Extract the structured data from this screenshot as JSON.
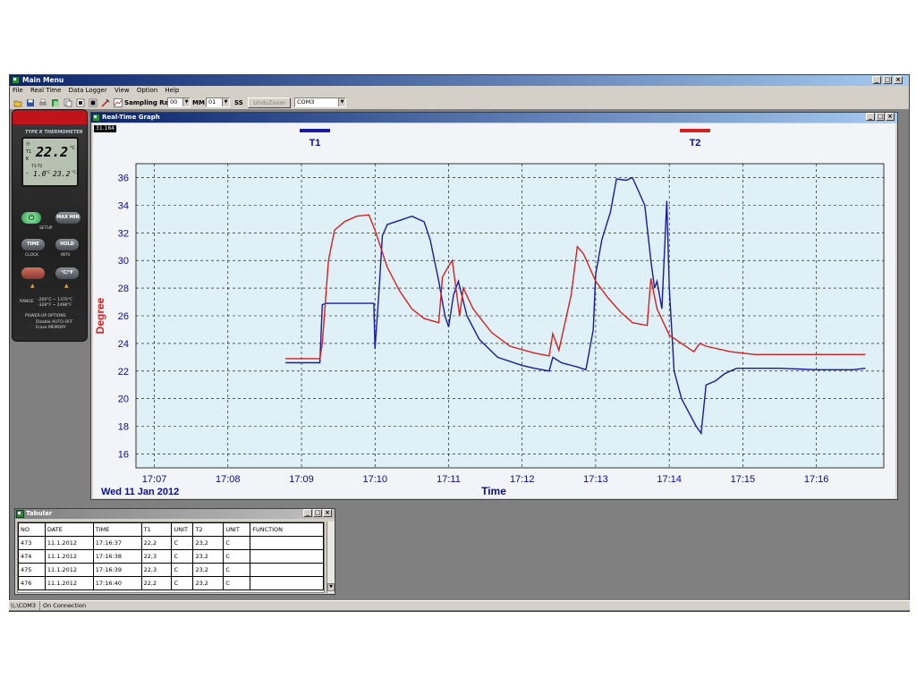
{
  "app": {
    "title": "Main Menu",
    "menu": [
      "File",
      "Real Time",
      "Data Logger",
      "View",
      "Option",
      "Help"
    ],
    "window_controls": [
      "_",
      "□",
      "×"
    ]
  },
  "toolbar": {
    "sampling_label": "Sampling Rate",
    "hh_value": "00",
    "mm_label": "MM",
    "mm_value": "01",
    "ss_label": "SS",
    "undo_zoom_label": "UndoZoom",
    "port_value": "COM3"
  },
  "meter": {
    "model": "TYPE K THERMOMETER",
    "main_reading": "22.2",
    "main_unit": "°C",
    "t1_label": "T1",
    "k_label": "K",
    "t1t2_label": "T1-T2",
    "diff_reading": "1.0",
    "diff_unit": "°C",
    "t2_reading": "23.2",
    "t2_unit": "°C",
    "power_btn": "⏻",
    "maxmin_btn": "MAX MIN",
    "setup": "SETUP",
    "time_btn": "TIME",
    "hold_btn": "HOLD",
    "clock": "CLOCK",
    "intv": "INTV",
    "unit_btn": "°C/°F",
    "range": "RANGE",
    "range_c": "-200°C ~ 1370°C",
    "range_f": "-328°F ~ 2498°F",
    "power_up": "POWER-UP OPTIONS",
    "opt1": "Disable AUTO-OFF",
    "opt2": "Erase MEMORY"
  },
  "graph_window": {
    "title": "Real-Time Graph",
    "point_readout": "31.184",
    "window_controls": [
      "_",
      "□",
      "×"
    ]
  },
  "tabular": {
    "title": "Tabular",
    "window_controls": [
      "_",
      "□",
      "×"
    ],
    "columns": [
      "NO",
      "DATE",
      "TIME",
      "T1",
      "UNIT",
      "T2",
      "UNIT",
      "FUNCTION"
    ],
    "rows": [
      [
        "473",
        "11.1.2012",
        "17:16:37",
        "22,2",
        "C",
        "23,2",
        "C",
        ""
      ],
      [
        "474",
        "11.1.2012",
        "17:16:38",
        "22,3",
        "C",
        "23,2",
        "C",
        ""
      ],
      [
        "475",
        "11.1.2012",
        "17:16:39",
        "22,3",
        "C",
        "23,2",
        "C",
        ""
      ],
      [
        "476",
        "11.1.2012",
        "17:16:40",
        "22,2",
        "C",
        "23,2",
        "C",
        ""
      ]
    ]
  },
  "status": {
    "port": "\\\\.\\COM3",
    "connection": "On Connection"
  },
  "colors": {
    "t1": "#1a1aa0",
    "t2": "#d42020",
    "axis_text": "#0a0a9a",
    "ylabel": "#d42020",
    "plot_bg": "#dff0f7"
  },
  "chart_data": {
    "type": "line",
    "title": "",
    "xlabel": "Time",
    "ylabel": "Degree",
    "date_label": "Wed 11 Jan 2012",
    "xlim": [
      "17:06:45",
      "17:16:55"
    ],
    "ylim": [
      15,
      37
    ],
    "x_ticks": [
      "17:07",
      "17:08",
      "17:09",
      "17:10",
      "17:11",
      "17:12",
      "17:13",
      "17:14",
      "17:15",
      "17:16"
    ],
    "y_ticks": [
      16,
      18,
      20,
      22,
      24,
      26,
      28,
      30,
      32,
      34,
      36
    ],
    "grid": true,
    "legend_position": "top",
    "series": [
      {
        "name": "T1",
        "color": "#1a1aa0",
        "points": [
          [
            "17:08:47",
            22.6
          ],
          [
            "17:09:15",
            22.6
          ],
          [
            "17:09:17",
            26.8
          ],
          [
            "17:09:20",
            26.9
          ],
          [
            "17:09:59",
            26.9
          ],
          [
            "17:10:00",
            23.6
          ],
          [
            "17:10:03",
            27.5
          ],
          [
            "17:10:06",
            31.8
          ],
          [
            "17:10:10",
            32.6
          ],
          [
            "17:10:20",
            32.9
          ],
          [
            "17:10:30",
            33.2
          ],
          [
            "17:10:40",
            32.8
          ],
          [
            "17:10:45",
            31.5
          ],
          [
            "17:10:52",
            28.5
          ],
          [
            "17:10:57",
            26.0
          ],
          [
            "17:11:00",
            25.2
          ],
          [
            "17:11:04",
            27.5
          ],
          [
            "17:11:08",
            28.5
          ],
          [
            "17:11:15",
            26.0
          ],
          [
            "17:11:25",
            24.3
          ],
          [
            "17:11:40",
            23.0
          ],
          [
            "17:12:00",
            22.4
          ],
          [
            "17:12:10",
            22.2
          ],
          [
            "17:12:22",
            22.0
          ],
          [
            "17:12:25",
            23.0
          ],
          [
            "17:12:32",
            22.6
          ],
          [
            "17:12:45",
            22.3
          ],
          [
            "17:12:52",
            22.1
          ],
          [
            "17:12:58",
            25.0
          ],
          [
            "17:13:00",
            29.0
          ],
          [
            "17:13:05",
            31.5
          ],
          [
            "17:13:12",
            33.5
          ],
          [
            "17:13:17",
            35.9
          ],
          [
            "17:13:25",
            35.8
          ],
          [
            "17:13:30",
            36.0
          ],
          [
            "17:13:35",
            35.0
          ],
          [
            "17:13:40",
            34.0
          ],
          [
            "17:13:45",
            30.0
          ],
          [
            "17:13:48",
            28.0
          ],
          [
            "17:13:50",
            28.5
          ],
          [
            "17:13:54",
            26.5
          ],
          [
            "17:13:58",
            34.3
          ],
          [
            "17:14:00",
            28.0
          ],
          [
            "17:14:04",
            22.0
          ],
          [
            "17:14:10",
            20.0
          ],
          [
            "17:14:16",
            19.0
          ],
          [
            "17:14:22",
            18.0
          ],
          [
            "17:14:26",
            17.5
          ],
          [
            "17:14:30",
            21.0
          ],
          [
            "17:14:38",
            21.3
          ],
          [
            "17:14:45",
            21.8
          ],
          [
            "17:14:55",
            22.2
          ],
          [
            "17:15:30",
            22.2
          ],
          [
            "17:16:00",
            22.1
          ],
          [
            "17:16:30",
            22.1
          ],
          [
            "17:16:40",
            22.2
          ]
        ]
      },
      {
        "name": "T2",
        "color": "#d42020",
        "points": [
          [
            "17:08:47",
            22.9
          ],
          [
            "17:09:15",
            22.9
          ],
          [
            "17:09:17",
            24.0
          ],
          [
            "17:09:22",
            30.0
          ],
          [
            "17:09:27",
            32.2
          ],
          [
            "17:09:35",
            32.8
          ],
          [
            "17:09:45",
            33.2
          ],
          [
            "17:09:55",
            33.3
          ],
          [
            "17:10:00",
            32.2
          ],
          [
            "17:10:10",
            29.5
          ],
          [
            "17:10:20",
            27.8
          ],
          [
            "17:10:30",
            26.5
          ],
          [
            "17:10:40",
            25.8
          ],
          [
            "17:10:52",
            25.5
          ],
          [
            "17:10:55",
            28.8
          ],
          [
            "17:11:00",
            29.6
          ],
          [
            "17:11:03",
            30.0
          ],
          [
            "17:11:06",
            28.0
          ],
          [
            "17:11:09",
            26.0
          ],
          [
            "17:11:12",
            28.0
          ],
          [
            "17:11:20",
            26.5
          ],
          [
            "17:11:35",
            24.8
          ],
          [
            "17:11:50",
            23.8
          ],
          [
            "17:12:10",
            23.3
          ],
          [
            "17:12:22",
            23.1
          ],
          [
            "17:12:25",
            24.7
          ],
          [
            "17:12:30",
            23.5
          ],
          [
            "17:12:40",
            27.5
          ],
          [
            "17:12:45",
            31.0
          ],
          [
            "17:12:50",
            30.5
          ],
          [
            "17:13:00",
            28.5
          ],
          [
            "17:13:10",
            27.3
          ],
          [
            "17:13:20",
            26.3
          ],
          [
            "17:13:30",
            25.5
          ],
          [
            "17:13:42",
            25.3
          ],
          [
            "17:13:45",
            28.7
          ],
          [
            "17:13:50",
            26.5
          ],
          [
            "17:14:00",
            24.6
          ],
          [
            "17:14:10",
            24.0
          ],
          [
            "17:14:20",
            23.4
          ],
          [
            "17:14:25",
            24.0
          ],
          [
            "17:14:30",
            23.8
          ],
          [
            "17:14:50",
            23.4
          ],
          [
            "17:15:10",
            23.2
          ],
          [
            "17:16:40",
            23.2
          ]
        ]
      }
    ]
  }
}
